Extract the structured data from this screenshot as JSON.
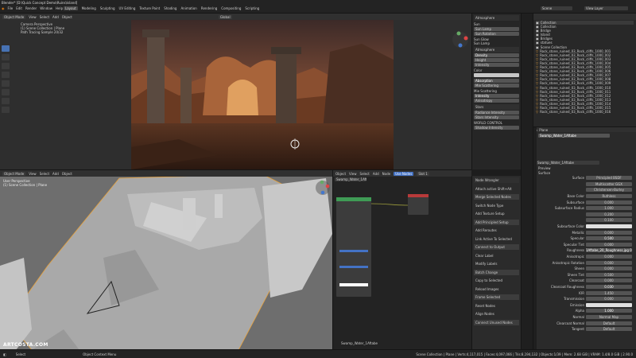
{
  "window": {
    "title": "Blender* [D:\\Quick Concept Demo\\Ruins\\island]"
  },
  "topbar": {
    "menus": [
      "File",
      "Edit",
      "Render",
      "Window",
      "Help"
    ],
    "workspaces": [
      "Layout",
      "Modeling",
      "Sculpting",
      "UV Editing",
      "Texture Paint",
      "Shading",
      "Animation",
      "Rendering",
      "Compositing",
      "Scripting"
    ],
    "scene_label": "Scene",
    "view_layer_label": "View Layer"
  },
  "viewport_top": {
    "mode": "Object Mode",
    "menus": [
      "View",
      "Select",
      "Add",
      "Object"
    ],
    "orientation": "Global",
    "overlay_title": "Camera Perspective",
    "overlay_lines": [
      "(1) Scene Collection | Plane",
      "Path Tracing Sample 20/32"
    ]
  },
  "atmosphere_panel": {
    "title": "Atmosphere",
    "sun_label": "Sun",
    "sun_rows": [
      "Sun Lamp",
      "Sun Rotation"
    ],
    "sections": [
      "Sun Glow",
      "Sun Lamp"
    ],
    "atmosphere_label": "Atmosphere",
    "params": [
      "Density",
      "Height",
      "Intensity"
    ],
    "color_label": "Color",
    "scattering_label": "Mie Scattering",
    "fields": [
      "Absorption",
      "Mie Scattering",
      "Intensity",
      "Anisotropy"
    ],
    "stars_label": "Stars",
    "star_rows": [
      "Radiance Intensity",
      "Stars Intensity",
      "WORLD CONTROL",
      "Shadow Intensity"
    ]
  },
  "outliner": {
    "title": "Scene Collection",
    "items": [
      "Collection",
      "Collection",
      "Bridge",
      "Island",
      "Bridges",
      "statues",
      "Scene Collection",
      "Rock_stone_ruined_03_Rock_cliffs_1000_001",
      "Rock_stone_ruined_03_Rock_cliffs_1000_002",
      "Rock_stone_ruined_03_Rock_cliffs_1000_003",
      "Rock_stone_ruined_03_Rock_cliffs_1000_004",
      "Rock_stone_ruined_03_Rock_cliffs_1000_005",
      "Rock_stone_ruined_03_Rock_cliffs_1000_006",
      "Rock_stone_ruined_03_Rock_cliffs_1000_007",
      "Rock_stone_ruined_03_Rock_cliffs_1000_008",
      "Rock_stone_ruined_03_Rock_cliffs_1000_009",
      "Rock_stone_ruined_03_Rock_cliffs_1000_010",
      "Rock_stone_ruined_03_Rock_cliffs_1000_011",
      "Rock_stone_ruined_03_Rock_cliffs_1000_012",
      "Rock_stone_ruined_03_Rock_cliffs_1000_013",
      "Rock_stone_ruined_03_Rock_cliffs_1000_014",
      "Rock_stone_ruined_03_Rock_cliffs_1000_015",
      "Rock_stone_ruined_03_Rock_cliffs_1000_016"
    ]
  },
  "properties": {
    "object_label": "Plane",
    "material_name": "Swamp_Water_1Aftabe",
    "material_slot": "Swamp_Water_1Aftabe",
    "preview_label": "Preview",
    "surface_section": "Surface",
    "rows": [
      {
        "label": "Surface",
        "value": "Principled BSDF"
      },
      {
        "label": "",
        "value": "Multiscatter GGX"
      },
      {
        "label": "",
        "value": "Christensen-Burley"
      },
      {
        "label": "Base Color",
        "value": "Ruthless"
      },
      {
        "label": "Subsurface",
        "value": "0.000"
      },
      {
        "label": "Subsurface Radius",
        "value": "1.000"
      },
      {
        "label": "",
        "value": "0.200"
      },
      {
        "label": "",
        "value": "0.100"
      },
      {
        "label": "Subsurface Color",
        "value": ""
      },
      {
        "label": "Metallic",
        "value": "0.000"
      },
      {
        "label": "Specular",
        "value": "0.500"
      },
      {
        "label": "Specular Tint",
        "value": "0.000"
      },
      {
        "label": "Roughness",
        "value": "1Aftabe_20_Roughness.jpg 0.00"
      },
      {
        "label": "Anisotropic",
        "value": "0.000"
      },
      {
        "label": "Anisotropic Rotation",
        "value": "0.000"
      },
      {
        "label": "Sheen",
        "value": "0.000"
      },
      {
        "label": "Sheen Tint",
        "value": "0.500"
      },
      {
        "label": "Clearcoat",
        "value": "0.000"
      },
      {
        "label": "Clearcoat Roughness",
        "value": "0.030"
      },
      {
        "label": "IOR",
        "value": "1.450"
      },
      {
        "label": "Transmission",
        "value": "0.000"
      },
      {
        "label": "Emission",
        "value": ""
      },
      {
        "label": "Alpha",
        "value": "1.000"
      },
      {
        "label": "Normal",
        "value": "Normal Map"
      },
      {
        "label": "Clearcoat Normal",
        "value": "Default"
      },
      {
        "label": "Tangent",
        "value": "Default"
      }
    ]
  },
  "viewport_bottom": {
    "mode": "Object Mode",
    "menus": [
      "View",
      "Select",
      "Add",
      "Object"
    ],
    "overlay_title": "User Perspective",
    "overlay_lines": [
      "(1) Scene Collection | Plane"
    ]
  },
  "node_editor": {
    "menus": [
      "Object",
      "View",
      "Select",
      "Add",
      "Node"
    ],
    "use_nodes": "Use Nodes",
    "slot": "Slot 1",
    "material": "Swamp_Water_1Aft",
    "footer_label": "Swamp_Water_1Aftabe"
  },
  "node_wrangler": {
    "title": "Node Wrangler",
    "items": [
      "Attach active Shift+Alt",
      "Merge Selected Nodes",
      "Switch Node Type",
      "Add Texture Setup",
      "Add Principled Setup",
      "Add Reroutes",
      "Link Active To Selected",
      "Connect to Output",
      "Clear Label",
      "Modify Labels",
      "Batch Change",
      "Copy to Selected",
      "Reload Images",
      "Frame Selected",
      "Reset Nodes",
      "Align Nodes",
      "Connect Unused Nodes"
    ]
  },
  "statusbar": {
    "left": "Select",
    "mid": "Object Context Menu",
    "right": "Scene Collection | Plane | Verts:4,117,015 | Faces:4,097,066 | Tris:8,194,132 | Objects:1/39 | Mem: 2.68 GiB | VRAM: 1.4/8.0 GiB | 2.90.0"
  },
  "watermark": "ARTCOSTA.COM",
  "colors": {
    "accent": "#4472c4",
    "sel_orange": "#e8a23c",
    "node_green": "#3f9b55",
    "node_red": "#b83a3a"
  }
}
